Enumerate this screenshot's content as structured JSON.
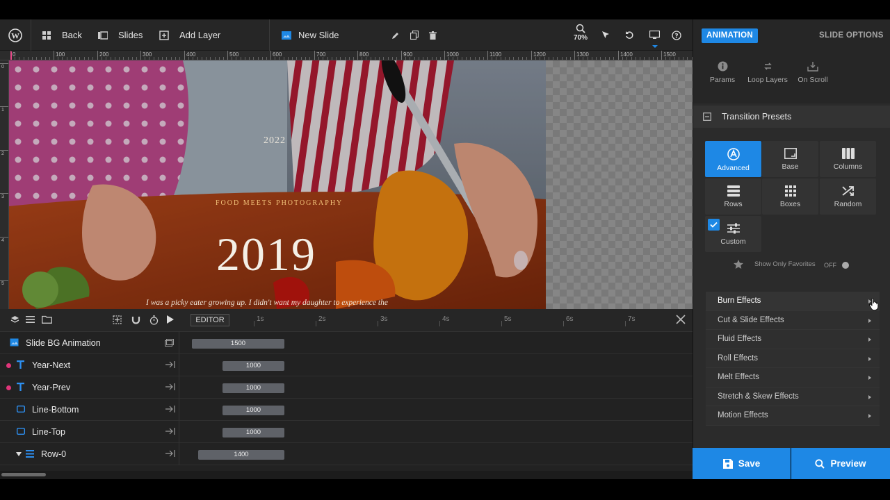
{
  "toolbar": {
    "back_label": "Back",
    "slides_label": "Slides",
    "add_layer_label": "Add Layer",
    "slide_name": "New Slide",
    "zoom": "70%"
  },
  "ruler": {
    "h_labels": [
      "0",
      "100",
      "200",
      "300",
      "400",
      "500",
      "600",
      "700",
      "800",
      "900",
      "1000",
      "1100",
      "1200",
      "1300",
      "1400",
      "1500"
    ],
    "v_labels": [
      "0",
      "1",
      "2",
      "3",
      "4",
      "5"
    ]
  },
  "slide": {
    "year_small": "2022",
    "kicker": "FOOD MEETS PHOTOGRAPHY",
    "year_big": "2019",
    "quote": "I was a picky eater growing up. I didn't want my daughter to experience the"
  },
  "timeline": {
    "editor_label": "EDITOR",
    "seconds": [
      "1s",
      "2s",
      "3s",
      "4s",
      "5s",
      "6s",
      "7s"
    ],
    "rows": [
      {
        "name": "Slide BG Animation",
        "duration": "1500"
      },
      {
        "name": "Year-Next",
        "duration": "1000"
      },
      {
        "name": "Year-Prev",
        "duration": "1000"
      },
      {
        "name": "Line-Bottom",
        "duration": "1000"
      },
      {
        "name": "Line-Top",
        "duration": "1000"
      },
      {
        "name": "Row-0",
        "duration": "1400"
      }
    ]
  },
  "panel": {
    "tab_animation": "ANIMATION",
    "tab_slide_options": "SLIDE OPTIONS",
    "subnav": [
      "Params",
      "Loop Layers",
      "On Scroll"
    ],
    "section_title": "Transition Presets",
    "presets": [
      "Advanced",
      "Base",
      "Columns",
      "Rows",
      "Boxes",
      "Random",
      "Custom"
    ],
    "favorites_label": "Show Only Favorites",
    "favorites_toggle": "OFF",
    "effects": [
      "Burn Effects",
      "Cut & Slide Effects",
      "Fluid Effects",
      "Roll Effects",
      "Melt Effects",
      "Stretch & Skew Effects",
      "Motion Effects"
    ],
    "save_label": "Save",
    "preview_label": "Preview"
  },
  "colors": {
    "accent": "#1e88e5",
    "toolbar_bg": "#262626",
    "panel_bg": "#2b2b2b",
    "layer_dot": "#e0357a"
  }
}
